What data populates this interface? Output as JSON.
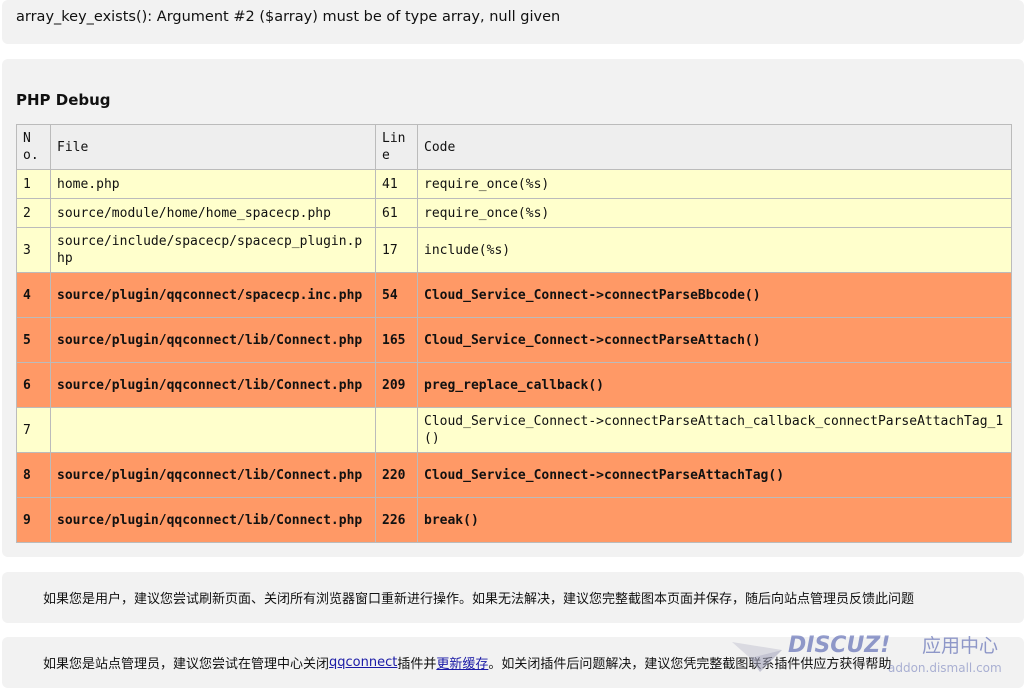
{
  "error": {
    "message": "array_key_exists(): Argument #2 ($array) must be of type array, null given"
  },
  "debug": {
    "title": "PHP Debug",
    "headers": {
      "no": "No.",
      "file": "File",
      "line": "Line",
      "code": "Code"
    },
    "rows": [
      {
        "no": "1",
        "file": "home.php",
        "line": "41",
        "code": "require_once(%s)",
        "kind": "user"
      },
      {
        "no": "2",
        "file": "source/module/home/home_spacecp.php",
        "line": "61",
        "code": "require_once(%s)",
        "kind": "user"
      },
      {
        "no": "3",
        "file": "source/include/spacecp/spacecp_plugin.php",
        "line": "17",
        "code": "include(%s)",
        "kind": "user"
      },
      {
        "no": "4",
        "file": "source/plugin/qqconnect/spacecp.inc.php",
        "line": "54",
        "code": "Cloud_Service_Connect->connectParseBbcode()",
        "kind": "plugin"
      },
      {
        "no": "5",
        "file": "source/plugin/qqconnect/lib/Connect.php",
        "line": "165",
        "code": "Cloud_Service_Connect->connectParseAttach()",
        "kind": "plugin"
      },
      {
        "no": "6",
        "file": "source/plugin/qqconnect/lib/Connect.php",
        "line": "209",
        "code": "preg_replace_callback()",
        "kind": "plugin"
      },
      {
        "no": "7",
        "file": "",
        "line": "",
        "code": "Cloud_Service_Connect->connectParseAttach_callback_connectParseAttachTag_1()",
        "kind": "user"
      },
      {
        "no": "8",
        "file": "source/plugin/qqconnect/lib/Connect.php",
        "line": "220",
        "code": "Cloud_Service_Connect->connectParseAttachTag()",
        "kind": "plugin"
      },
      {
        "no": "9",
        "file": "source/plugin/qqconnect/lib/Connect.php",
        "line": "226",
        "code": "break()",
        "kind": "plugin"
      }
    ]
  },
  "hints": {
    "user": "如果您是用户，建议您尝试刷新页面、关闭所有浏览器窗口重新进行操作。如果无法解决，建议您完整截图本页面并保存，随后向站点管理员反馈此问题",
    "admin_prefix": "如果您是站点管理员，建议您尝试在管理中心关闭 ",
    "admin_link1": "qqconnect",
    "admin_middle": " 插件并 ",
    "admin_link2": "更新缓存",
    "admin_suffix": " 。如关闭插件后问题解决，建议您凭完整截图联系插件供应方获得帮助"
  },
  "watermark": {
    "brand": "DISCUZ!",
    "cn": "应用中心",
    "url": "addon.dismall.com"
  },
  "colors": {
    "user_row": "#ffffcc",
    "plugin_row": "#ff9966",
    "link": "#1a1aa6"
  }
}
